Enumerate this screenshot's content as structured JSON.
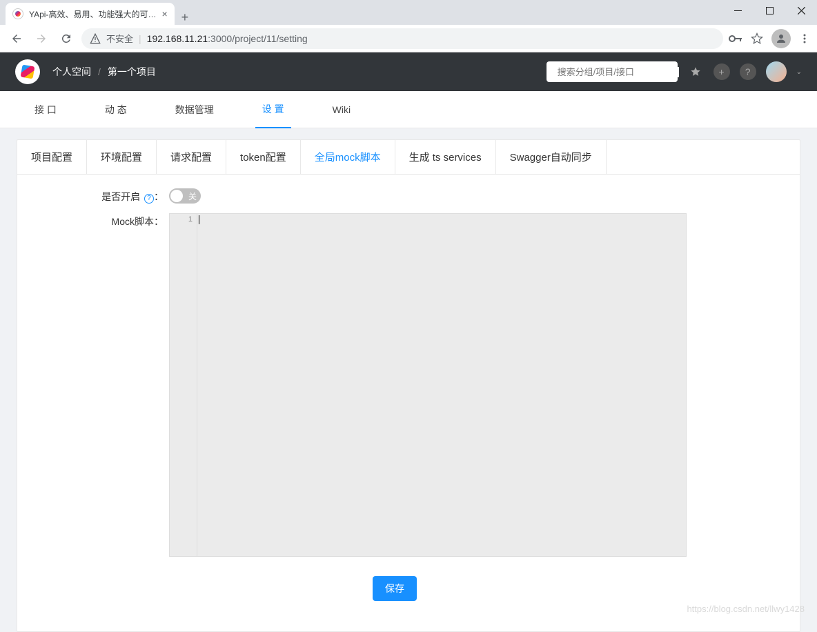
{
  "browser": {
    "tab_title": "YApi-高效、易用、功能强大的可…",
    "url_prefix": "不安全",
    "url_host": "192.168.11.21",
    "url_port_path": ":3000/project/11/setting"
  },
  "header": {
    "breadcrumb_space": "个人空间",
    "breadcrumb_sep": "/",
    "breadcrumb_project": "第一个项目",
    "search_placeholder": "搜索分组/项目/接口"
  },
  "main_tabs": [
    {
      "label": "接 口",
      "active": false
    },
    {
      "label": "动 态",
      "active": false
    },
    {
      "label": "数据管理",
      "active": false
    },
    {
      "label": "设 置",
      "active": true
    },
    {
      "label": "Wiki",
      "active": false
    }
  ],
  "sub_tabs": [
    {
      "label": "项目配置",
      "active": false
    },
    {
      "label": "环境配置",
      "active": false
    },
    {
      "label": "请求配置",
      "active": false
    },
    {
      "label": "token配置",
      "active": false
    },
    {
      "label": "全局mock脚本",
      "active": true
    },
    {
      "label": "生成 ts services",
      "active": false
    },
    {
      "label": "Swagger自动同步",
      "active": false
    }
  ],
  "form": {
    "enable_label": "是否开启",
    "enable_help": "?",
    "toggle_off_text": "关",
    "script_label": "Mock脚本：",
    "line_number": "1",
    "save_button": "保存"
  },
  "watermark": "https://blog.csdn.net/llwy1428"
}
